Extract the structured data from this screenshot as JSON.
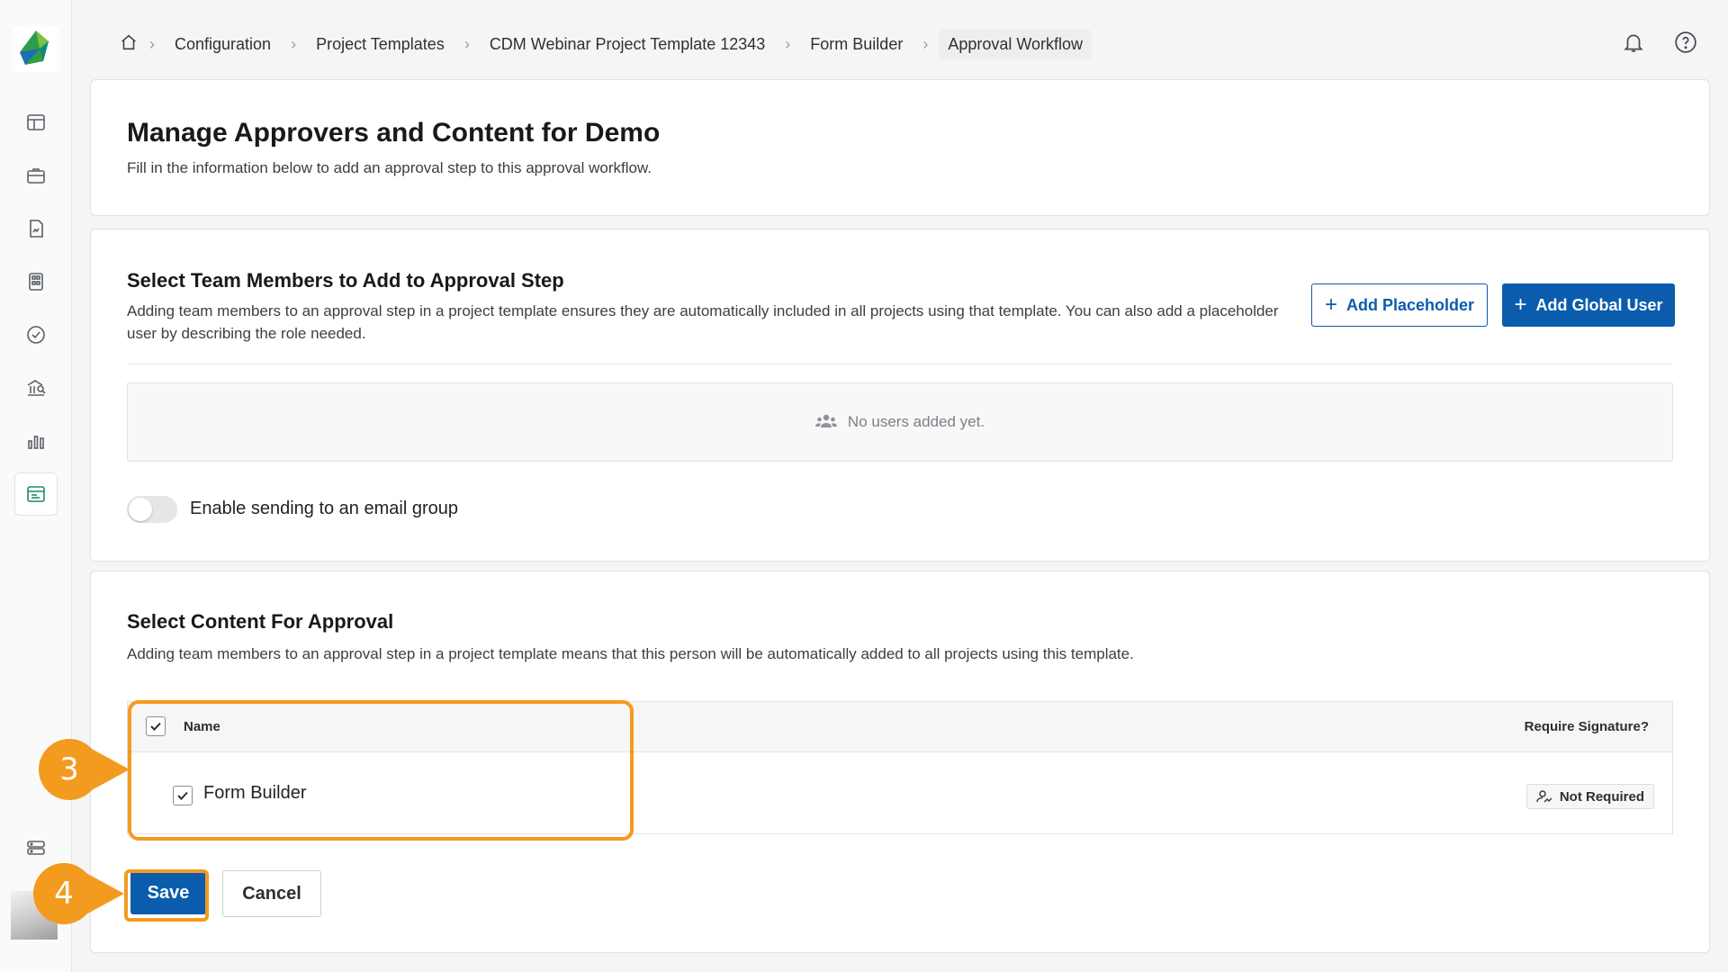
{
  "breadcrumb": {
    "items": [
      "Configuration",
      "Project Templates",
      "CDM Webinar Project Template 12343",
      "Form Builder"
    ],
    "current": "Approval Workflow"
  },
  "header_card": {
    "title": "Manage Approvers and Content for Demo",
    "description": "Fill in the information below to add an approval step to this approval workflow."
  },
  "team_section": {
    "title": "Select Team Members to Add to Approval Step",
    "description": "Adding team members to an approval step in a project template ensures they are automatically included in all projects using that template. You can also add a placeholder user by describing the role needed.",
    "add_placeholder_label": "Add Placeholder",
    "add_global_user_label": "Add Global User",
    "empty_text": "No users added yet.",
    "toggle_label": "Enable sending to an email group",
    "toggle_on": false
  },
  "content_section": {
    "title": "Select Content For Approval",
    "description": "Adding team members to an approval step in a project template means that this person will be automatically added to all projects using this template.",
    "table": {
      "columns": [
        "Name",
        "Require Signature?"
      ],
      "rows": [
        {
          "name": "Form Builder",
          "signature": "Not Required",
          "checked": true
        }
      ]
    },
    "save_label": "Save",
    "cancel_label": "Cancel"
  },
  "annotations": {
    "step_3": "3",
    "step_4": "4",
    "color": "#f39b1f"
  },
  "colors": {
    "primary": "#0b5cad",
    "active_nav": "#1b8a6b"
  }
}
